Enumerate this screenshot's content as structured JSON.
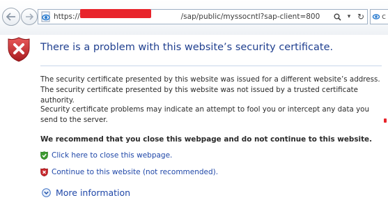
{
  "browser": {
    "url_prefix": "https://",
    "url_suffix": "/sap/public/myssocntl?sap-client=800",
    "controls": {
      "search": "⚲",
      "dropdown": "▾",
      "refresh": "↻"
    },
    "tab_glyph": "c"
  },
  "page": {
    "title": "There is a problem with this website’s security certificate.",
    "paragraph1": "The security certificate presented by this website was issued for a different website’s address.",
    "paragraph2": "The security certificate presented by this website was not issued by a trusted certificate authority.",
    "paragraph3": "Security certificate problems may indicate an attempt to fool you or intercept any data you send to the server.",
    "recommendation": "We recommend that you close this webpage and do not continue to this website.",
    "close_link": "Click here to close this webpage.",
    "continue_link": "Continue to this website (not recommended).",
    "more_info": "More information"
  },
  "colors": {
    "title": "#1f3f8f",
    "link": "#1f47a8",
    "shield_red": "#c8262b",
    "ok_green": "#3c9a2f",
    "redaction": "#e8242b"
  },
  "icons": {
    "back": "back-arrow-icon",
    "forward": "forward-arrow-icon",
    "page": "ie-page-icon",
    "shield": "red-shield-x-icon",
    "close_option": "green-shield-check-icon",
    "continue_option": "red-shield-x-icon",
    "more_info": "circle-chevron-down-icon"
  }
}
